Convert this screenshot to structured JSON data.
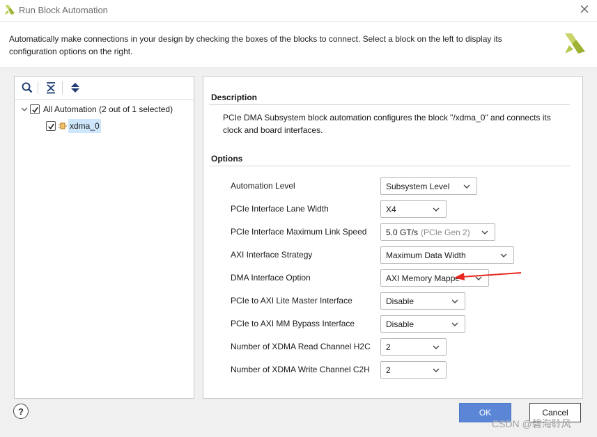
{
  "window": {
    "title": "Run Block Automation",
    "logo_icon": "xilinx-logo-icon",
    "close_icon": "close-icon"
  },
  "header": {
    "description": "Automatically make connections in your design by checking the boxes of the blocks to connect. Select a block on the left to display its configuration options on the right."
  },
  "tree": {
    "toolbar": [
      "search-icon",
      "collapse-all-icon",
      "expand-all-icon"
    ],
    "root_label": "All Automation (2 out of 1 selected)",
    "root_checked": true,
    "child_label": "xdma_0",
    "child_checked": true
  },
  "details": {
    "description_heading": "Description",
    "description_body": "PCIe DMA Subsystem block automation configures the block \"/xdma_0\" and connects its clock and board interfaces.",
    "options_heading": "Options",
    "options": [
      {
        "label": "Automation Level",
        "value": "Subsystem Level",
        "hint": ""
      },
      {
        "label": "PCIe Interface Lane Width",
        "value": "X4",
        "hint": ""
      },
      {
        "label": "PCIe Interface Maximum Link Speed",
        "value": "5.0 GT/s",
        "hint": "(PCIe Gen 2)"
      },
      {
        "label": "AXI Interface Strategy",
        "value": "Maximum Data Width",
        "hint": ""
      },
      {
        "label": "DMA Interface Option",
        "value": "AXI Memory Mappe",
        "hint": ""
      },
      {
        "label": "PCIe to AXI Lite Master Interface",
        "value": "Disable",
        "hint": ""
      },
      {
        "label": "PCIe to AXI MM Bypass Interface",
        "value": "Disable",
        "hint": ""
      },
      {
        "label": "Number of XDMA Read Channel H2C",
        "value": "2",
        "hint": ""
      },
      {
        "label": "Number of XDMA Write Channel C2H",
        "value": "2",
        "hint": ""
      }
    ]
  },
  "footer": {
    "help_label": "?",
    "ok_label": "OK",
    "cancel_label": "Cancel"
  },
  "watermark": "CSDN @碧海聆风",
  "colors": {
    "ok_button": "#5b86d6",
    "selection": "#cde6fb",
    "annotation_arrow": "#e8281e",
    "xilinx_logo": "#b6c64a"
  }
}
